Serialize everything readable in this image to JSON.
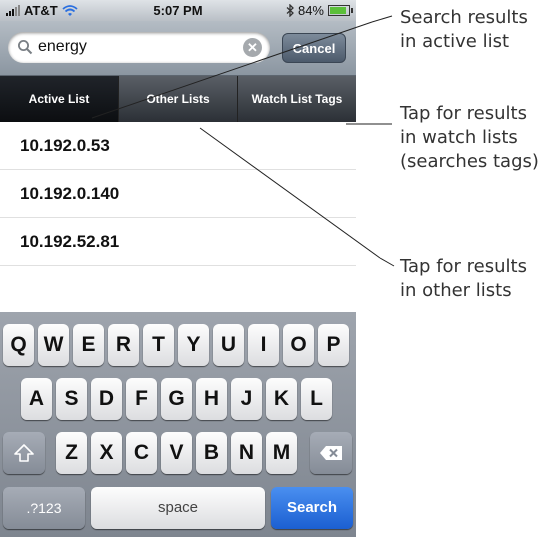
{
  "status_bar": {
    "carrier": "AT&T",
    "time": "5:07 PM",
    "battery": "84%",
    "icons": [
      "signal-bars-icon",
      "wifi-icon",
      "bluetooth-icon",
      "battery-icon"
    ]
  },
  "search": {
    "value": "energy",
    "cancel_label": "Cancel",
    "icons": [
      "search-icon",
      "clear-icon"
    ]
  },
  "scope_tabs": [
    {
      "label": "Active List",
      "selected": true
    },
    {
      "label": "Other  Lists",
      "selected": false
    },
    {
      "label": "Watch List Tags",
      "selected": false
    }
  ],
  "results": [
    {
      "label": "10.192.0.53"
    },
    {
      "label": "10.192.0.140"
    },
    {
      "label": "10.192.52.81"
    }
  ],
  "keyboard": {
    "row1": [
      "Q",
      "W",
      "E",
      "R",
      "T",
      "Y",
      "U",
      "I",
      "O",
      "P"
    ],
    "row2": [
      "A",
      "S",
      "D",
      "F",
      "G",
      "H",
      "J",
      "K",
      "L"
    ],
    "row3": [
      "Z",
      "X",
      "C",
      "V",
      "B",
      "N",
      "M"
    ],
    "numbers_key": ".?123",
    "space_key": "space",
    "search_key": "Search",
    "icons": [
      "shift-icon",
      "backspace-icon"
    ]
  },
  "callouts": {
    "search_results": "Search results\nin active list",
    "watch_lists": "Tap for results\nin watch lists\n(searches tags)",
    "other_lists": "Tap for results\nin other lists"
  },
  "colors": {
    "search_key": "#2a6fe0",
    "battery_fill": "#5bbf3a",
    "scope_active": "#111418"
  }
}
